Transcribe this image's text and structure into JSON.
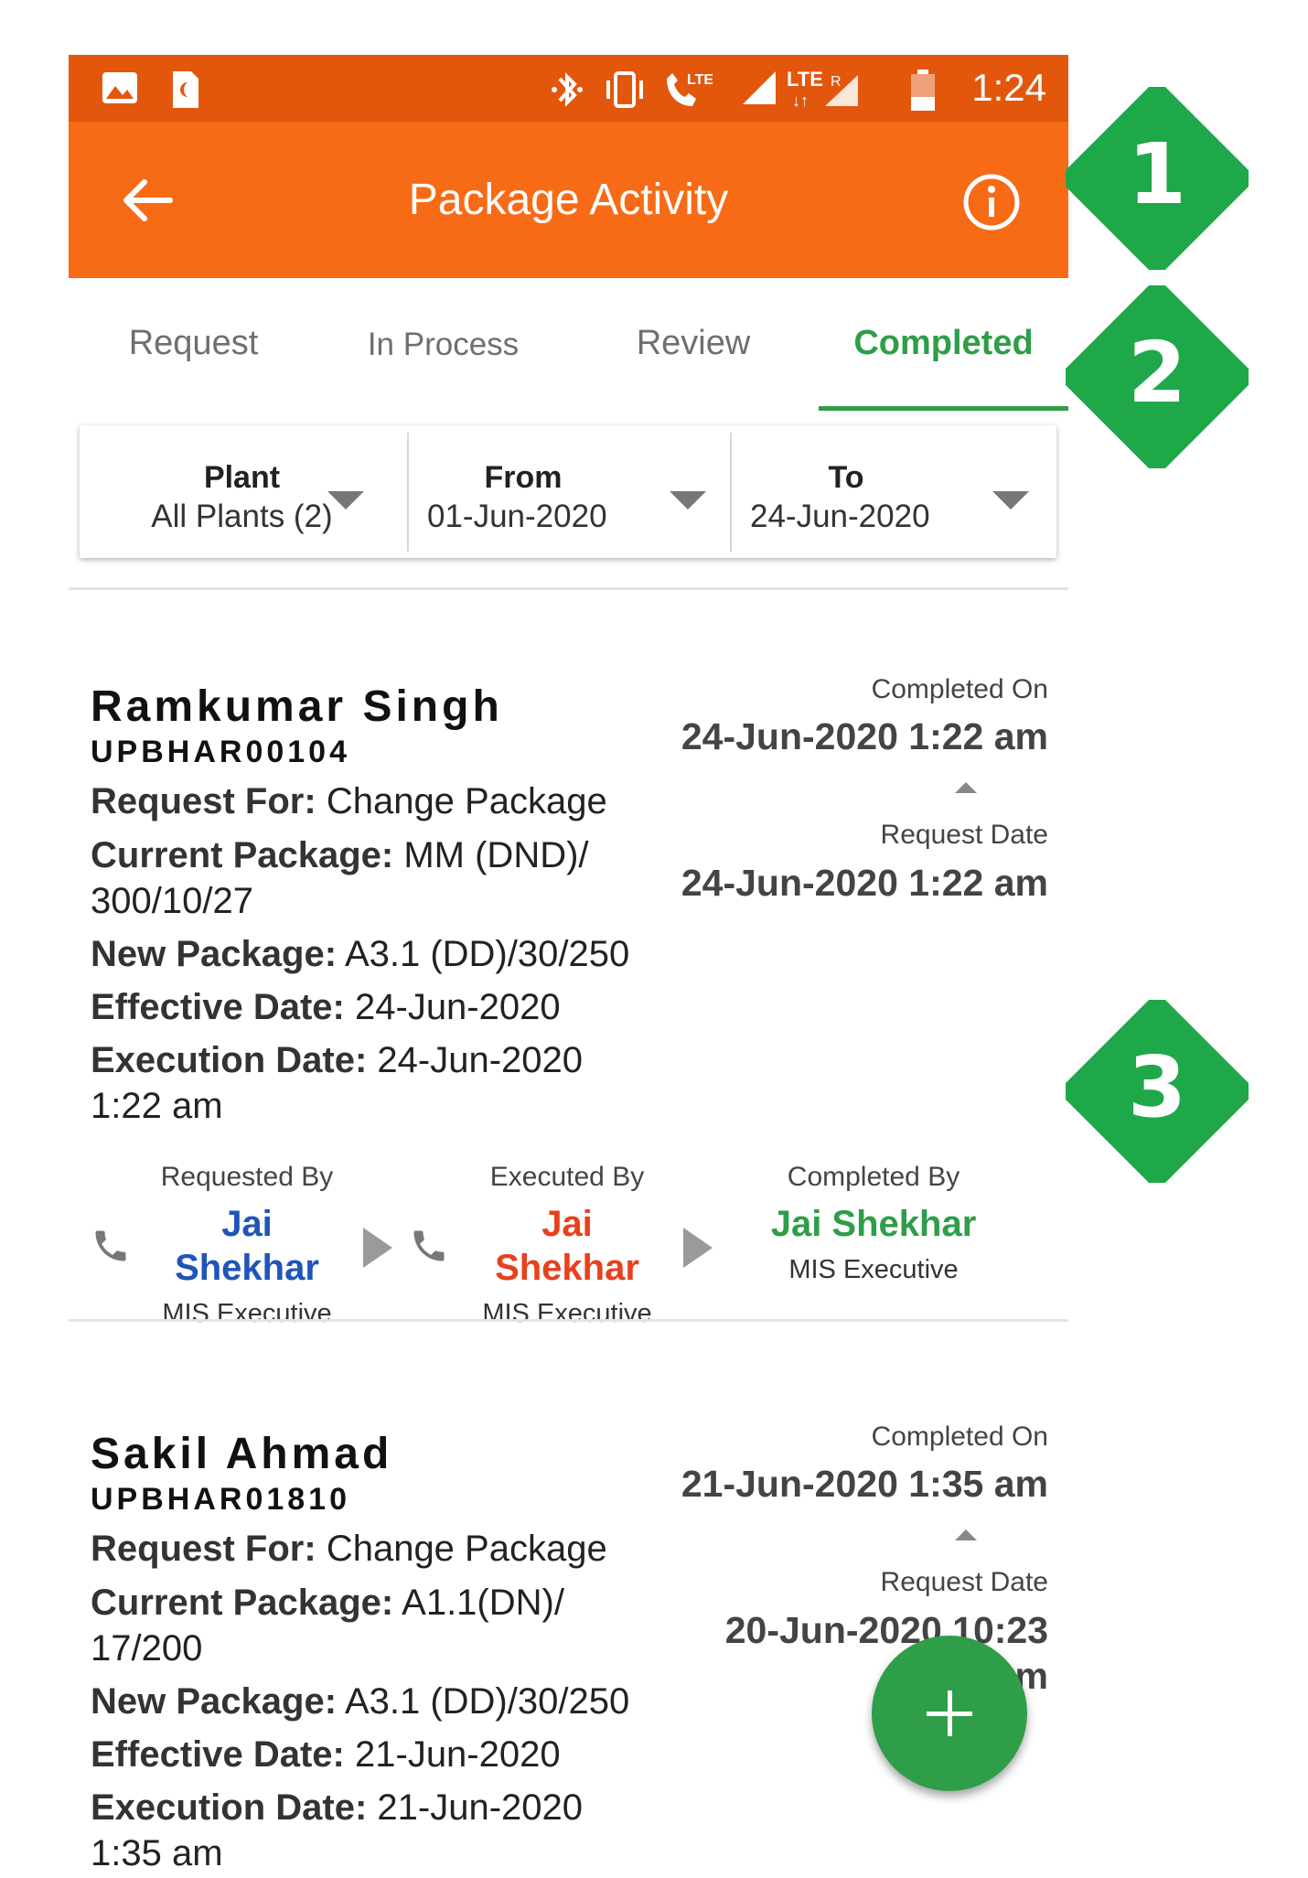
{
  "status_bar": {
    "time": "1:24"
  },
  "toolbar": {
    "title": "Package Activity"
  },
  "tabs": [
    {
      "label": "Request"
    },
    {
      "label": "In Process"
    },
    {
      "label": "Review"
    },
    {
      "label": "Completed",
      "active": true
    }
  ],
  "filter": {
    "plant": {
      "label": "Plant",
      "value": "All Plants (2)"
    },
    "from": {
      "label": "From",
      "value": "01-Jun-2020"
    },
    "to": {
      "label": "To",
      "value": "24-Jun-2020"
    }
  },
  "cards": [
    {
      "name": "Ramkumar Singh",
      "code": "UPBHAR00104",
      "request_for_label": "Request For:",
      "request_for": "Change Package",
      "current_package_label": "Current Package:",
      "current_package": "MM (DND)/ 300/10/27",
      "new_package_label": "New Package:",
      "new_package": "A3.1 (DD)/30/250",
      "effective_date_label": "Effective Date:",
      "effective_date": "24-Jun-2020",
      "execution_date_label": "Execution Date:",
      "execution_date": "24-Jun-2020 1:22 am",
      "completed_on_label": "Completed On",
      "completed_on": "24-Jun-2020 1:22 am",
      "request_date_label": "Request Date",
      "request_date": "24-Jun-2020 1:22 am",
      "requested_by": {
        "label": "Requested By",
        "name": "Jai Shekhar",
        "role": "MIS Executive"
      },
      "executed_by": {
        "label": "Executed By",
        "name": "Jai Shekhar",
        "role": "MIS Executive"
      },
      "completed_by": {
        "label": "Completed By",
        "name": "Jai Shekhar",
        "role": "MIS Executive"
      }
    },
    {
      "name": "Sakil Ahmad",
      "code": "UPBHAR01810",
      "request_for_label": "Request For:",
      "request_for": "Change Package",
      "current_package_label": "Current Package:",
      "current_package": "A1.1(DN)/ 17/200",
      "new_package_label": "New Package:",
      "new_package": "A3.1 (DD)/30/250",
      "effective_date_label": "Effective Date:",
      "effective_date": "21-Jun-2020",
      "execution_date_label": "Execution Date:",
      "execution_date": "21-Jun-2020 1:35 am",
      "completed_on_label": "Completed On",
      "completed_on": "21-Jun-2020 1:35 am",
      "request_date_label": "Request Date",
      "request_date": "20-Jun-2020 10:23 pm"
    }
  ],
  "callouts": [
    "1",
    "2",
    "3"
  ],
  "colors": {
    "status_bar": "#E2570C",
    "toolbar": "#F76B16",
    "accent_green": "#2e9e48",
    "callout_green": "#1FA84A",
    "requested_blue": "#1f55b8",
    "executed_red": "#e8401c"
  },
  "icons": [
    "image-icon",
    "sim-icon",
    "bluetooth-icon",
    "vibrate-icon",
    "wifi-call-icon",
    "signal-icon",
    "battery-icon",
    "back-arrow-icon",
    "info-icon",
    "phone-icon",
    "play-arrow-icon",
    "plus-icon"
  ]
}
